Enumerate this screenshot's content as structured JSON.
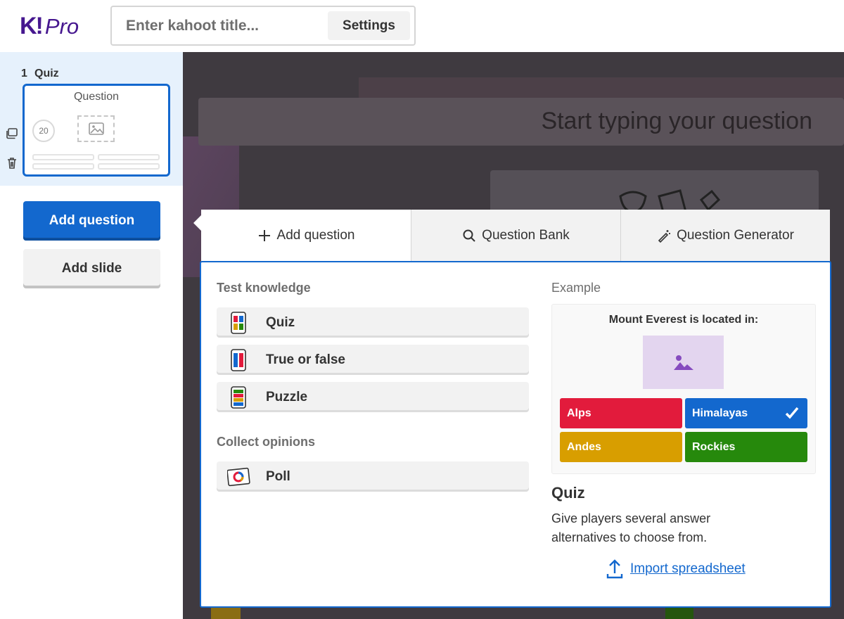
{
  "header": {
    "logo_k": "K!",
    "logo_pro": "Pro",
    "title_placeholder": "Enter kahoot title...",
    "settings_label": "Settings"
  },
  "sidebar": {
    "slide": {
      "number": "1",
      "type": "Quiz",
      "thumb_title": "Question",
      "timer": "20"
    },
    "add_question_label": "Add question",
    "add_slide_label": "Add slide"
  },
  "canvas": {
    "question_placeholder": "Start typing your question"
  },
  "popup": {
    "tabs": [
      {
        "label": "Add question",
        "icon": "plus-icon",
        "active": true
      },
      {
        "label": "Question Bank",
        "icon": "search-icon",
        "active": false
      },
      {
        "label": "Question Generator",
        "icon": "magic-wand-icon",
        "active": false
      }
    ],
    "sections": {
      "test_knowledge": "Test knowledge",
      "collect_opinions": "Collect opinions"
    },
    "question_types": {
      "quiz": "Quiz",
      "true_false": "True or false",
      "puzzle": "Puzzle",
      "poll": "Poll"
    },
    "example": {
      "label": "Example",
      "question": "Mount Everest is located in:",
      "answers": [
        {
          "text": "Alps",
          "color": "#e21b3c",
          "correct": false
        },
        {
          "text": "Himalayas",
          "color": "#1368ce",
          "correct": true
        },
        {
          "text": "Andes",
          "color": "#d89e00",
          "correct": false
        },
        {
          "text": "Rockies",
          "color": "#26890c",
          "correct": false
        }
      ],
      "title": "Quiz",
      "description": "Give players several answer alternatives to choose from."
    },
    "import_label": "Import spreadsheet"
  },
  "colors": {
    "brand": "#46178f",
    "accent_blue": "#1368ce"
  }
}
